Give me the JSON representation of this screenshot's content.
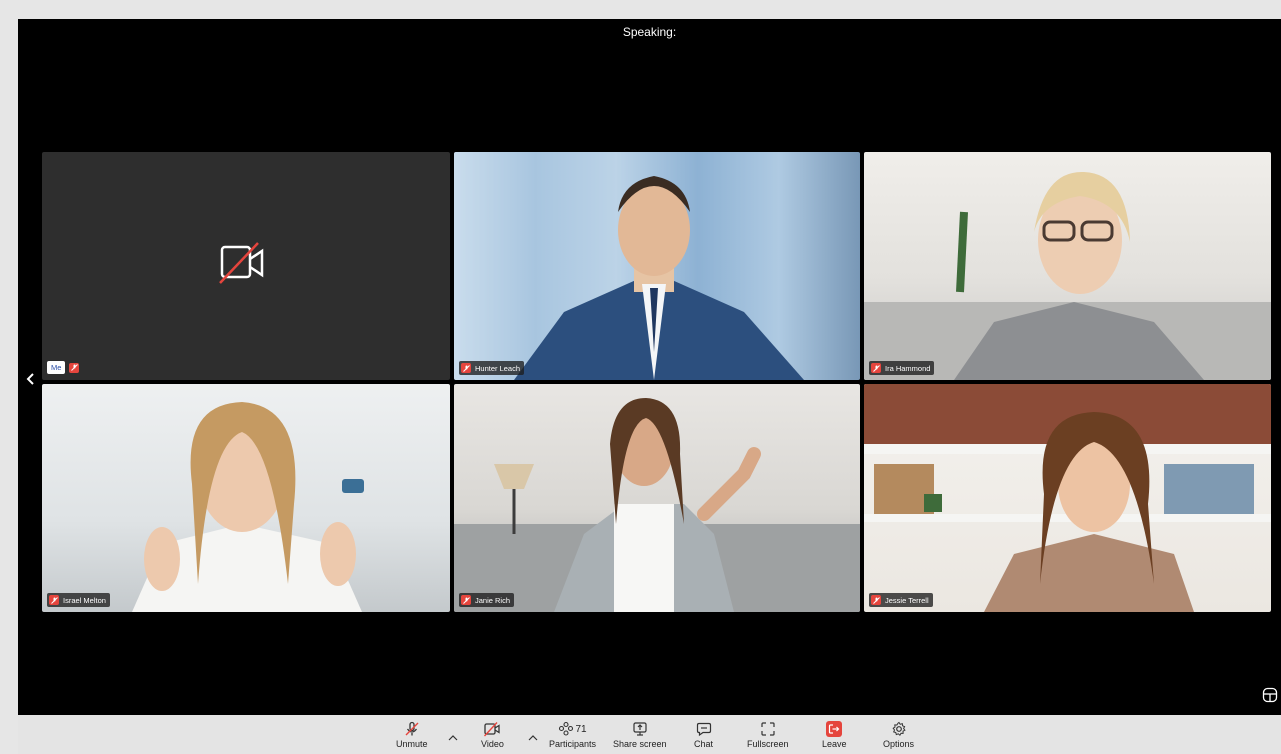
{
  "header": {
    "speaking_label": "Speaking:"
  },
  "self_tile": {
    "me_label": "Me"
  },
  "participants_tiles": [
    {
      "name": "Hunter Leach"
    },
    {
      "name": "Ira Hammond"
    },
    {
      "name": "Israel Melton"
    },
    {
      "name": "Janie Rich"
    },
    {
      "name": "Jessie Terrell"
    }
  ],
  "toolbar": {
    "unmute": "Unmute",
    "video": "Video",
    "participants": "Participants",
    "participants_count": "71",
    "share_screen": "Share screen",
    "chat": "Chat",
    "fullscreen": "Fullscreen",
    "leave": "Leave",
    "options": "Options"
  },
  "colors": {
    "mic_off": "#e5453d",
    "leave": "#e5453d",
    "toolbar_bg": "#e4e4e4"
  }
}
